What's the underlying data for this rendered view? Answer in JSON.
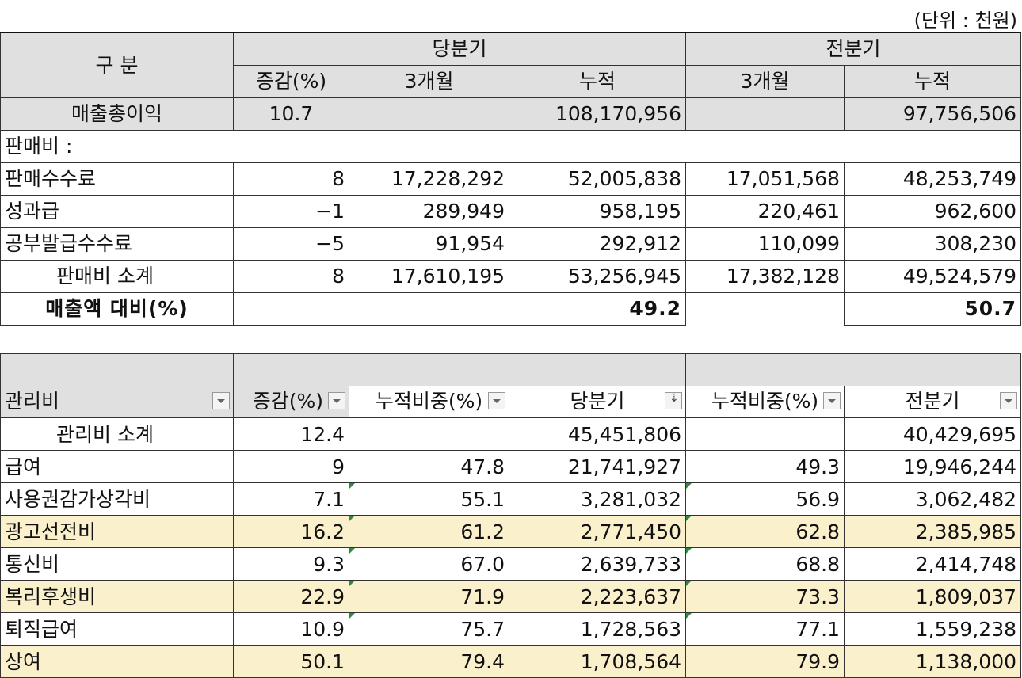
{
  "unit_label": "(단위 : 천원)",
  "sales": {
    "header": {
      "category": "구  분",
      "current": "당분기",
      "previous": "전분기",
      "change": "증감(%)",
      "three_month": "3개월",
      "cumulative": "누적",
      "prev_three_month": "3개월",
      "prev_cumulative": "누적"
    },
    "gross": {
      "label": "매출총이익",
      "change": "10.7",
      "cur_3m": "",
      "cur_cum": "108,170,956",
      "prev_3m": "",
      "prev_cum": "97,756,506"
    },
    "section_label": "판매비 :",
    "rows": [
      {
        "label": "판매수수료",
        "change": "8",
        "cur_3m": "17,228,292",
        "cur_cum": "52,005,838",
        "prev_3m": "17,051,568",
        "prev_cum": "48,253,749"
      },
      {
        "label": "성과급",
        "change": "−1",
        "cur_3m": "289,949",
        "cur_cum": "958,195",
        "prev_3m": "220,461",
        "prev_cum": "962,600"
      },
      {
        "label": "공부발급수수료",
        "change": "−5",
        "cur_3m": "91,954",
        "cur_cum": "292,912",
        "prev_3m": "110,099",
        "prev_cum": "308,230"
      }
    ],
    "subtotal": {
      "label": "판매비 소계",
      "change": "8",
      "cur_3m": "17,610,195",
      "cur_cum": "53,256,945",
      "prev_3m": "17,382,128",
      "prev_cum": "49,524,579"
    },
    "ratio": {
      "label": "매출액 대비(%)",
      "cur_cum": "49.2",
      "prev_cum": "50.7"
    }
  },
  "admin": {
    "header": {
      "label": "관리비",
      "change": "증감(%)",
      "cur_weight": "누적비중(%)",
      "current": "당분기",
      "prev_weight": "누적비중(%)",
      "previous": "전분기"
    },
    "subtotal": {
      "label": "관리비 소계",
      "change": "12.4",
      "cur_weight": "",
      "current": "45,451,806",
      "prev_weight": "",
      "previous": "40,429,695"
    },
    "rows": [
      {
        "label": "급여",
        "change": "9",
        "cur_weight": "47.8",
        "current": "21,741,927",
        "prev_weight": "49.3",
        "previous": "19,946,244"
      },
      {
        "label": "사용권감가상각비",
        "change": "7.1",
        "cur_weight": "55.1",
        "current": "3,281,032",
        "prev_weight": "56.9",
        "previous": "3,062,482"
      },
      {
        "label": "광고선전비",
        "change": "16.2",
        "cur_weight": "61.2",
        "current": "2,771,450",
        "prev_weight": "62.8",
        "previous": "2,385,985"
      },
      {
        "label": "통신비",
        "change": "9.3",
        "cur_weight": "67.0",
        "current": "2,639,733",
        "prev_weight": "68.8",
        "previous": "2,414,748"
      },
      {
        "label": "복리후생비",
        "change": "22.9",
        "cur_weight": "71.9",
        "current": "2,223,637",
        "prev_weight": "73.3",
        "previous": "1,809,037"
      },
      {
        "label": "퇴직급여",
        "change": "10.9",
        "cur_weight": "75.7",
        "current": "1,728,563",
        "prev_weight": "77.1",
        "previous": "1,559,238"
      },
      {
        "label": "상여",
        "change": "50.1",
        "cur_weight": "79.4",
        "current": "1,708,564",
        "prev_weight": "79.9",
        "previous": "1,138,000"
      }
    ],
    "highlight_color": "#fbf0cc",
    "header_color": "#e0e0e0"
  }
}
